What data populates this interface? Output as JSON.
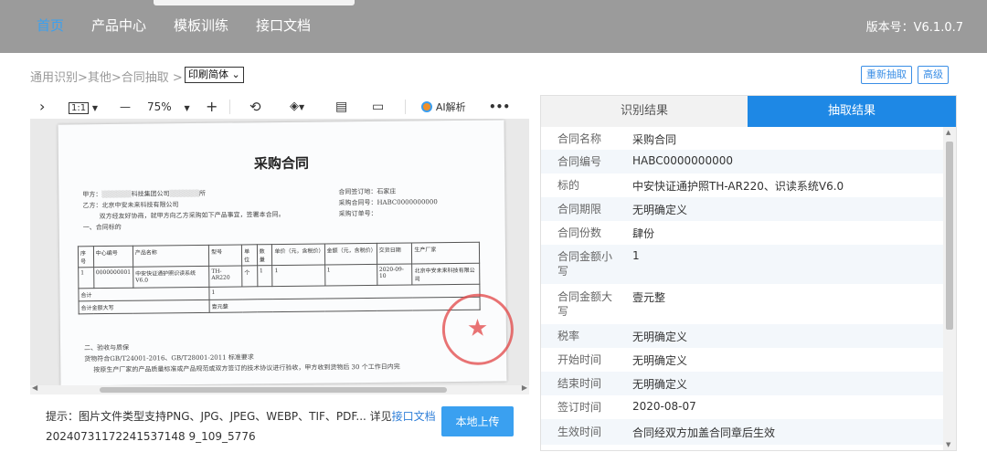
{
  "nav": {
    "items": [
      "首页",
      "产品中心",
      "模板训练",
      "接口文档"
    ],
    "version": "版本号：V6.1.0.7"
  },
  "breadcrumb": {
    "text": "通用识别>其他>合同抽取 >",
    "select_value": "印刷简体"
  },
  "actions": {
    "re_extract": "重新抽取",
    "advanced": "高级"
  },
  "toolbar": {
    "expand": "›",
    "fit": "1:1",
    "minus": "—",
    "zoom": "75%",
    "plus": "+",
    "ai": "AI解析",
    "more": "•••"
  },
  "document": {
    "title": "采购合同",
    "party_a": "甲方：",
    "party_a_rest": "科技集团公司",
    "party_a_end": "所",
    "party_b": "乙方：北京中安未来科技有限公司",
    "intro": "双方经友好协商，就甲方向乙方采购如下产品事宜，签署本合同。",
    "section1": "一、合同标的",
    "sign_place": "合同签订地：石家庄",
    "contract_no": "采购合同号：HABC0000000000",
    "order_no": "采购订单号：",
    "table_headers": [
      "序号",
      "中心编号",
      "产品名称",
      "型号",
      "单位",
      "数量",
      "单价（元，含税价）",
      "金额（元，含税价）",
      "交货日期",
      "生产厂家"
    ],
    "table_row": [
      "1",
      "0000000001",
      "中安快证通护照识读系统 V6.0",
      "TH-AR220",
      "个",
      "1",
      "1",
      "1",
      "2020-09-10",
      "北京中安未来科技有限公司"
    ],
    "total_label": "合计",
    "total_value": "1",
    "total_cap_label": "合计金额大写",
    "total_cap_value": "壹元整",
    "section2": "二、验收与质保",
    "line_a": "货物符合GB/T24001-2016、GB/T28001-2011 标准要求",
    "line_b": "按原生产厂家的产品质量标准或产品规范或双方签订的技术协议进行验收，甲方收到货物后 30 个工作日内完"
  },
  "upload": {
    "tip_prefix": "提示：图片文件类型支持PNG、JPG、JPEG、WEBP、TIF、PDF...  详见",
    "tip_link": "接口文档",
    "filename": "20240731172241537148 9_109_5776",
    "button": "本地上传"
  },
  "result": {
    "tabs": [
      "识别结果",
      "抽取结果"
    ],
    "fields": [
      {
        "k": "合同名称",
        "v": "采购合同"
      },
      {
        "k": "合同编号",
        "v": "HABC0000000000"
      },
      {
        "k": "标的",
        "v": "中安快证通护照TH-AR220、识读系统V6.0"
      },
      {
        "k": "合同期限",
        "v": "无明确定义"
      },
      {
        "k": "合同份数",
        "v": "肆份"
      },
      {
        "k": "合同金额小写",
        "v": "1"
      },
      {
        "k": "合同金额大写",
        "v": "壹元整"
      },
      {
        "k": "税率",
        "v": "无明确定义"
      },
      {
        "k": "开始时间",
        "v": "无明确定义"
      },
      {
        "k": "结束时间",
        "v": "无明确定义"
      },
      {
        "k": "签订时间",
        "v": "2020-08-07"
      },
      {
        "k": "生效时间",
        "v": "合同经双方加盖合同章后生效"
      }
    ]
  },
  "colors": {
    "accent": "#1e88e5",
    "nav_bg": "#9b9b9b",
    "stamp": "#e24545"
  }
}
